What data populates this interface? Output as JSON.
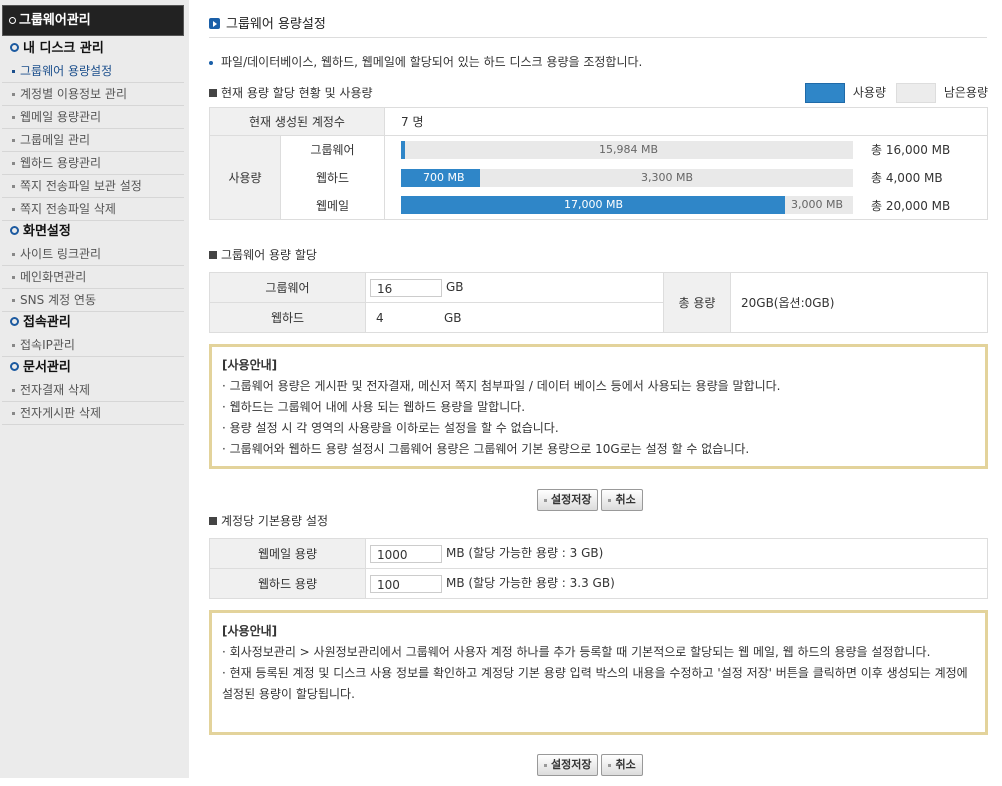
{
  "sidebar": {
    "title": "그룹웨어관리",
    "sections": [
      {
        "label": "내 디스크 관리",
        "items": [
          "그룹웨어 용량설정",
          "계정별 이용정보 관리",
          "웹메일 용량관리",
          "그룹메일 관리",
          "웹하드 용량관리",
          "쪽지 전송파일 보관 설정",
          "쪽지 전송파일 삭제"
        ]
      },
      {
        "label": "화면설정",
        "items": [
          "사이트 링크관리",
          "메인화면관리",
          "SNS 계정 연동"
        ]
      },
      {
        "label": "접속관리",
        "items": [
          "접속IP관리"
        ]
      },
      {
        "label": "문서관리",
        "items": [
          "전자결재 삭제",
          "전자게시판 삭제"
        ]
      }
    ]
  },
  "page": {
    "title": "그룹웨어 용량설정",
    "description": "파일/데이터베이스, 웹하드, 웹메일에 할당되어 있는 하드 디스크 용량을 조정합니다."
  },
  "usage": {
    "heading": "현재 용량 할당 현황 및 사용량",
    "legend_used": "사용량",
    "legend_free": "남은용량",
    "accounts_label": "현재 생성된 계정수",
    "accounts_value": "7 명",
    "usage_label": "사용량",
    "rows": [
      {
        "label": "그룹웨어",
        "used_pct": 0.1,
        "used_text": "",
        "free_text": "15,984 MB",
        "total": "총 16,000 MB"
      },
      {
        "label": "웹하드",
        "used_pct": 17.5,
        "used_text": "700 MB",
        "free_text": "3,300 MB",
        "total": "총 4,000 MB"
      },
      {
        "label": "웹메일",
        "used_pct": 85,
        "used_text": "17,000 MB",
        "free_text": "3,000 MB",
        "total": "총 20,000 MB"
      }
    ]
  },
  "alloc": {
    "heading": "그룹웨어 용량 할당",
    "gw_label": "그룹웨어",
    "gw_value": "16",
    "gw_unit": "GB",
    "wh_label": "웹하드",
    "wh_value": "4",
    "wh_unit": "GB",
    "total_label": "총 용량",
    "total_value": "20GB(옵션:0GB)"
  },
  "notice1": {
    "title": "[사용안내]",
    "lines": [
      "· 그룹웨어 용량은 게시판 및 전자결재, 메신저 쪽지 첨부파일 / 데이터 베이스 등에서 사용되는 용량을 말합니다.",
      "· 웹하드는 그룹웨어 내에 사용 되는 웹하드 용량을 말합니다.",
      "· 용량 설정 시 각 영역의 사용량을 이하로는 설정을 할 수 없습니다.",
      "· 그룹웨어와 웹하드 용량 설정시 그룹웨어 용량은 그룹웨어 기본 용량으로 10G로는 설정 할 수 없습니다."
    ]
  },
  "buttons": {
    "save": "설정저장",
    "cancel": "취소"
  },
  "per_account": {
    "heading": "계정당 기본용량 설정",
    "mail_label": "웹메일 용량",
    "mail_value": "1000",
    "mail_hint": "MB (할당 가능한 용량 : 3 GB)",
    "hard_label": "웹하드 용량",
    "hard_value": "100",
    "hard_hint": "MB (할당 가능한 용량 : 3.3 GB)"
  },
  "notice2": {
    "title": "[사용안내]",
    "lines": [
      "· 회사정보관리 > 사원정보관리에서 그룹웨어 사용자 계정 하나를 추가 등록할 때 기본적으로 할당되는 웹 메일, 웹 하드의 용량을 설정합니다.",
      "· 현재 등록된 계정 및 디스크 사용 정보를 확인하고 계정당 기본 용량 입력 박스의 내용을 수정하고 '설정 저장' 버튼을 클릭하면 이후 생성되는 계정에 설정된 용량이 할당됩니다."
    ]
  },
  "colors": {
    "bar_used": "#2f86c8",
    "bar_free": "#e9e9e9",
    "notice_border": "#e3d39b",
    "accent": "#1a5fa8"
  }
}
